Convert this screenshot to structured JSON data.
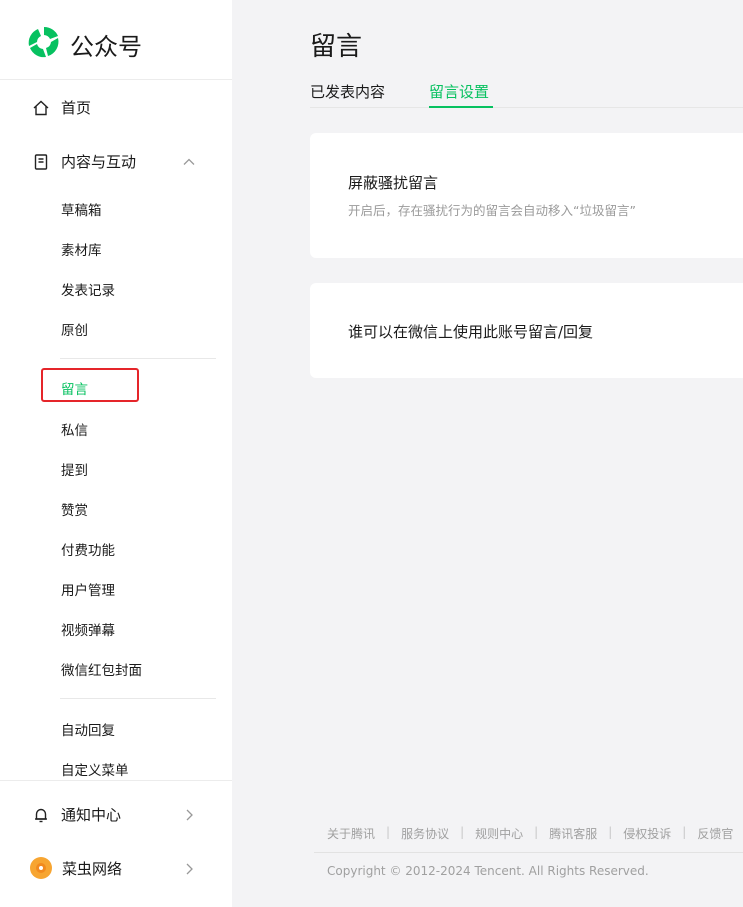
{
  "brand": {
    "name": "公众号",
    "color": "#07c160"
  },
  "sidebar": {
    "home": {
      "label": "首页",
      "icon": "home-icon"
    },
    "content": {
      "label": "内容与互动",
      "icon": "document-icon",
      "expanded": true,
      "items": [
        {
          "label": "草稿箱"
        },
        {
          "label": "素材库"
        },
        {
          "label": "发表记录"
        },
        {
          "label": "原创"
        },
        {
          "label": "留言",
          "active": true
        },
        {
          "label": "私信"
        },
        {
          "label": "提到"
        },
        {
          "label": "赞赏"
        },
        {
          "label": "付费功能"
        },
        {
          "label": "用户管理"
        },
        {
          "label": "视频弹幕"
        },
        {
          "label": "微信红包封面"
        },
        {
          "label": "自动回复"
        },
        {
          "label": "自定义菜单"
        }
      ]
    },
    "notifications": {
      "label": "通知中心",
      "icon": "bell-icon"
    },
    "account": {
      "label": "菜虫网络",
      "icon": "avatar-icon"
    }
  },
  "main": {
    "title": "留言",
    "tabs": [
      {
        "label": "已发表内容",
        "active": false
      },
      {
        "label": "留言设置",
        "active": true
      }
    ],
    "cards": [
      {
        "title": "屏蔽骚扰留言",
        "description": "开启后，存在骚扰行为的留言会自动移入“垃圾留言”"
      },
      {
        "title": "谁可以在微信上使用此账号留言/回复"
      }
    ]
  },
  "footer": {
    "links": [
      "关于腾讯",
      "服务协议",
      "规则中心",
      "腾讯客服",
      "侵权投诉",
      "反馈官"
    ],
    "copyright": "Copyright © 2012-2024 Tencent. All Rights Reserved."
  },
  "colors": {
    "accent": "#07c160",
    "highlight": "#e5252a",
    "background": "#f3f3f5"
  }
}
